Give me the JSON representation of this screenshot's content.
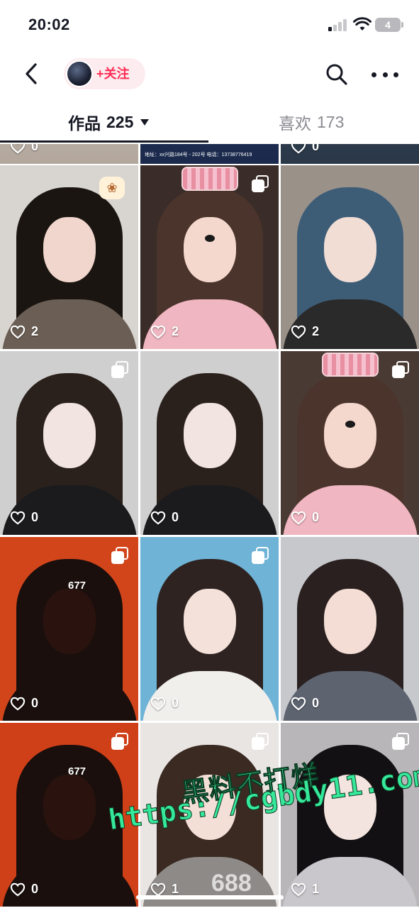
{
  "status_bar": {
    "time": "20:02",
    "battery": "4"
  },
  "profile": {
    "follow_label": "+关注"
  },
  "tabs": {
    "works_label": "作品",
    "works_count": "225",
    "likes_label": "喜欢",
    "likes_count": "173"
  },
  "top_row_likes": [
    "0",
    "",
    "0"
  ],
  "top_row_text": "地址：xx兴路184号 - 202号  电话：13738776419",
  "grid": [
    {
      "likes": "2",
      "multi": false,
      "sticker": true,
      "palette": {
        "bg": "#d8d4cf",
        "hair": "#1b1512",
        "face": "#f0d6cc",
        "body": "#6b5f55"
      }
    },
    {
      "likes": "2",
      "multi": true,
      "ears": true,
      "palette": {
        "bg": "#3a2c28",
        "hair": "#4a342b",
        "face": "#f4d7cd",
        "body": "#f0b6c1"
      }
    },
    {
      "likes": "2",
      "multi": false,
      "palette": {
        "bg": "#9a9189",
        "hair": "#3d5d77",
        "face": "#f2ddd5",
        "body": "#2a2a2a"
      }
    },
    {
      "likes": "0",
      "multi": true,
      "palette": {
        "bg": "#cfcfcf",
        "hair": "#2b211c",
        "face": "#f2e4e0",
        "body": "#1b1b1d"
      }
    },
    {
      "likes": "0",
      "multi": false,
      "palette": {
        "bg": "#cfcfcf",
        "hair": "#2b211c",
        "face": "#f2e4e0",
        "body": "#1b1b1d"
      }
    },
    {
      "likes": "0",
      "multi": true,
      "ears": true,
      "palette": {
        "bg": "#4a3a34",
        "hair": "#4a342b",
        "face": "#f4d7cd",
        "body": "#f0b6c1"
      }
    },
    {
      "likes": "0",
      "multi": true,
      "overlay": "677",
      "palette": {
        "bg": "#d2451b",
        "hair": "#1a0f0c",
        "face": "#2a130e",
        "body": "#1a0f0c"
      }
    },
    {
      "likes": "0",
      "multi": true,
      "palette": {
        "bg": "#6fb3d6",
        "hair": "#2e2320",
        "face": "#f3e1da",
        "body": "#f1efec"
      }
    },
    {
      "likes": "0",
      "multi": false,
      "palette": {
        "bg": "#c6c8cc",
        "hair": "#2a2020",
        "face": "#f3ddd4",
        "body": "#5d6470"
      }
    },
    {
      "likes": "0",
      "multi": true,
      "overlay": "677",
      "palette": {
        "bg": "#cf4018",
        "hair": "#1a0f0c",
        "face": "#2a130e",
        "body": "#1a0f0c"
      }
    },
    {
      "likes": "1",
      "multi": true,
      "palette": {
        "bg": "#e9e5e2",
        "hair": "#3a2a22",
        "face": "#f3dfd6",
        "body": "#8d8a88"
      }
    },
    {
      "likes": "1",
      "multi": true,
      "palette": {
        "bg": "#b8b6b8",
        "hair": "#121012",
        "face": "#f3e4df",
        "body": "#c9c7cb"
      }
    }
  ],
  "watermark": {
    "line1": "黑料不打烊",
    "line2": "https://cgbdy11.com",
    "number": "688"
  }
}
